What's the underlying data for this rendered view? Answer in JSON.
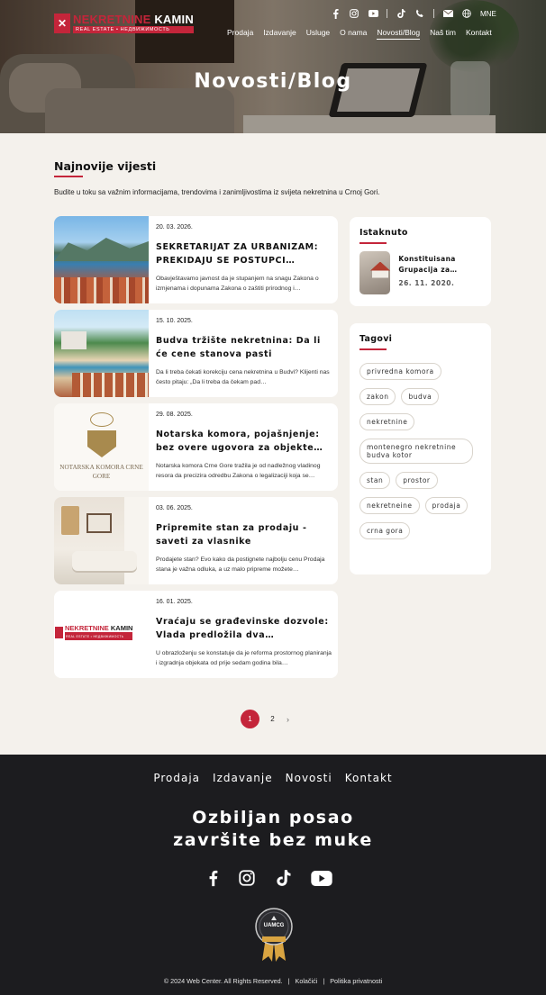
{
  "header": {
    "logo": {
      "name_part1": "NEKRETNINE",
      "name_part2": "KAMIN",
      "subtitle": "REAL ESTATE • НЕДВИЖИМОСТЬ"
    },
    "social_icons": [
      "facebook-icon",
      "instagram-icon",
      "youtube-icon",
      "tiktok-icon",
      "phone-icon",
      "mail-icon",
      "globe-icon"
    ],
    "language": "MNE",
    "nav": [
      "Prodaja",
      "Izdavanje",
      "Usluge",
      "O nama",
      "Novosti/Blog",
      "Naš tim",
      "Kontakt"
    ],
    "active_nav": "Novosti/Blog",
    "hero_title": "Novosti/Blog"
  },
  "section": {
    "title": "Najnovije vijesti",
    "description": "Budite u toku sa važnim informacijama, trendovima i zanimljivostima iz svijeta nekretnina u Crnoj Gori."
  },
  "posts": [
    {
      "date": "20. 03. 2026.",
      "title": "SEKRETARIJAT ZA URBANIZAM: PREKIDAJU SE POSTUPCI…",
      "excerpt": "Obavještavamo javnost da je stupanjem na snagu Zakona o izmjenama i dopunama Zakona o zaštiti prirodnog i…"
    },
    {
      "date": "15. 10. 2025.",
      "title": "Budva tržište nekretnina: Da li će cene stanova pasti",
      "excerpt": "Da li treba čekati korekciju cena nekretnina u Budvi? Klijenti nas često pitaju: „Da li treba da čekam pad…"
    },
    {
      "date": "29. 08. 2025.",
      "title": "Notarska komora, pojašnjenje: bez overe ugovora za objekte…",
      "excerpt": "Notarska komora Crne Gore tražila je od nadležnog vladinog resora da precizira odredbu Zakona o legalizaciji koja se…",
      "thumb_text": "NOTARSKA KOMORA CRNE GORE"
    },
    {
      "date": "03. 06. 2025.",
      "title": "Pripremite stan za prodaju - saveti za vlasnike",
      "excerpt": "Prodajete stan? Evo kako da postignete najbolju cenu Prodaja stana je važna odluka, a uz malo pripreme možete…"
    },
    {
      "date": "16. 01. 2025.",
      "title": "Vraćaju se građevinske dozvole: Vlada predložila dva…",
      "excerpt": "U obrazloženju se konstatuje da je reforma prostornog planiranja i izgradnja objekata od prije sedam godina bila…"
    }
  ],
  "sidebar": {
    "featured_title": "Istaknuto",
    "featured": {
      "title": "Konstituisana Grupacija za…",
      "date": "26. 11. 2020."
    },
    "tags_title": "Tagovi",
    "tags": [
      "privredna komora",
      "zakon",
      "budva",
      "nekretnine",
      "montenegro nekretnine budva kotor",
      "stan",
      "prostor",
      "nekretneine",
      "prodaja",
      "crna gora"
    ]
  },
  "pagination": {
    "current": "1",
    "next_page": "2",
    "next_icon": "chevron-right-icon"
  },
  "footer": {
    "nav": [
      "Prodaja",
      "Izdavanje",
      "Novosti",
      "Kontakt"
    ],
    "slogan_line1": "Ozbiljan posao",
    "slogan_line2": "završite bez muke",
    "social": [
      "facebook-icon",
      "instagram-icon",
      "tiktok-icon",
      "youtube-icon"
    ],
    "badge_text": "UAMCG",
    "copyright": "© 2024 Web Center. All Rights Reserved.",
    "cookies": "Kolačići",
    "privacy": "Politika privatnosti"
  },
  "colors": {
    "accent": "#c4253a",
    "footer_bg": "#1c1c1f",
    "page_bg": "#f4f1ec"
  }
}
